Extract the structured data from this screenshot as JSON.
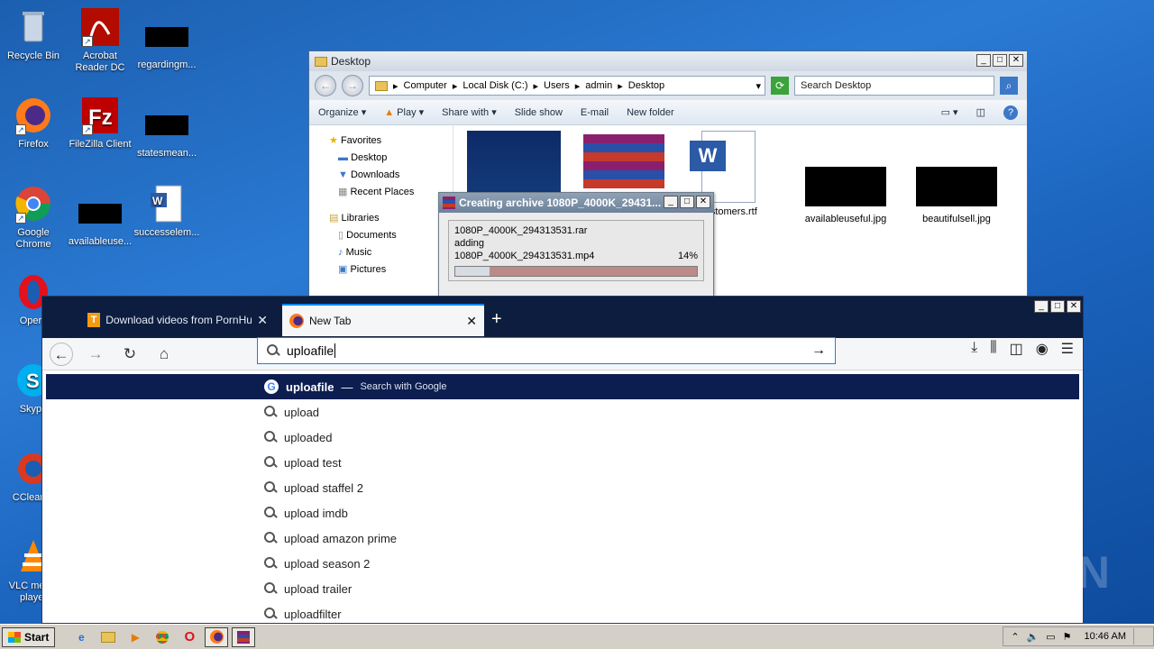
{
  "desktop": {
    "icons": [
      {
        "label": "Recycle Bin"
      },
      {
        "label": "Acrobat Reader DC"
      },
      {
        "label": "regardingm..."
      },
      {
        "label": "Firefox"
      },
      {
        "label": "FileZilla Client"
      },
      {
        "label": "statesmean..."
      },
      {
        "label": "Google Chrome"
      },
      {
        "label": "availableuse..."
      },
      {
        "label": "successelem..."
      },
      {
        "label": "Opera"
      },
      {
        "label": "Skype"
      },
      {
        "label": "CCleaner"
      },
      {
        "label": "VLC media player"
      }
    ]
  },
  "explorer": {
    "title": "Desktop",
    "breadcrumb": [
      "Computer",
      "Local Disk (C:)",
      "Users",
      "admin",
      "Desktop"
    ],
    "search_placeholder": "Search Desktop",
    "toolbar": {
      "organize": "Organize",
      "play": "Play",
      "share_with": "Share with",
      "slide_show": "Slide show",
      "email": "E-mail",
      "new_folder": "New folder"
    },
    "nav": {
      "favorites": "Favorites",
      "desktop": "Desktop",
      "downloads": "Downloads",
      "recent": "Recent Places",
      "libraries": "Libraries",
      "documents": "Documents",
      "music": "Music",
      "pictures": "Pictures"
    },
    "files": [
      "customers.rtf",
      "availableuseful.jpg",
      "beautifulsell.jpg"
    ]
  },
  "rar": {
    "title": "Creating archive 1080P_4000K_29431...",
    "archive": "1080P_4000K_294313531.rar",
    "action": "adding",
    "file": "1080P_4000K_294313531.mp4",
    "percent": "14%",
    "progress": 0.14
  },
  "firefox": {
    "tabs": [
      {
        "title": "Download videos from PornHub to"
      },
      {
        "title": "New Tab"
      }
    ],
    "url_value": "uploafile",
    "first_suggestion": {
      "term": "uploafile",
      "dash": "—",
      "hint": "Search with Google"
    },
    "suggestions": [
      "upload",
      "uploaded",
      "upload test",
      "upload staffel 2",
      "upload imdb",
      "upload amazon prime",
      "upload season 2",
      "upload trailer",
      "uploadfilter"
    ]
  },
  "taskbar": {
    "start": "Start",
    "clock": "10:46 AM"
  },
  "watermark": "ANY RUN"
}
